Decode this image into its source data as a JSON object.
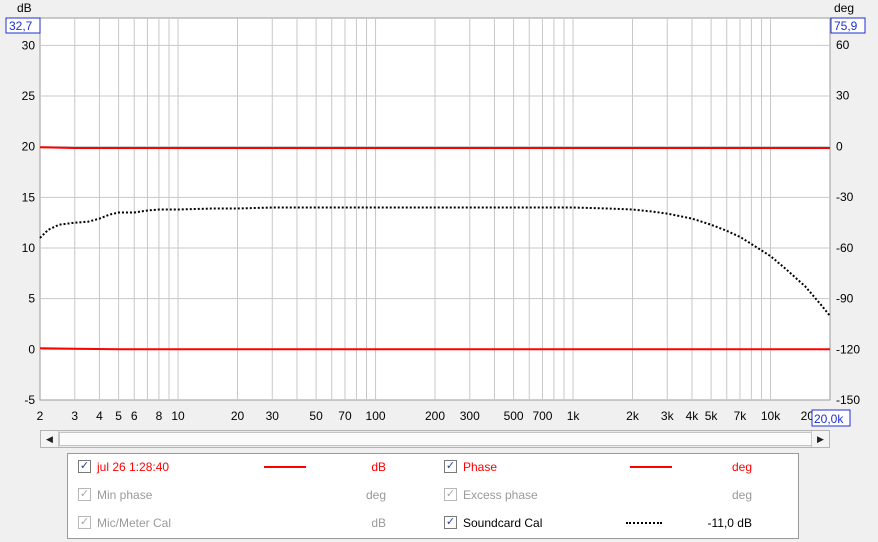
{
  "chart_data": {
    "type": "line",
    "left_axis_label": "dB",
    "right_axis_label": "deg",
    "left_top_value": "32,7",
    "right_top_value": "75,9",
    "right_end_value": "20,0k",
    "xscale": "log",
    "xlim": [
      2,
      20000
    ],
    "ylim_left": [
      -5,
      32.7
    ],
    "ylim_right": [
      -150,
      75.9
    ],
    "y_ticks_left": [
      30,
      25,
      20,
      15,
      10,
      5,
      0,
      -5
    ],
    "y_ticks_right": [
      60,
      30,
      0,
      -30,
      -60,
      -90,
      -120,
      -150
    ],
    "x_ticks": [
      {
        "v": 2,
        "label": "2"
      },
      {
        "v": 3,
        "label": "3"
      },
      {
        "v": 4,
        "label": "4"
      },
      {
        "v": 5,
        "label": "5"
      },
      {
        "v": 6,
        "label": "6"
      },
      {
        "v": 8,
        "label": "8"
      },
      {
        "v": 10,
        "label": "10"
      },
      {
        "v": 20,
        "label": "20"
      },
      {
        "v": 30,
        "label": "30"
      },
      {
        "v": 50,
        "label": "50"
      },
      {
        "v": 70,
        "label": "70"
      },
      {
        "v": 100,
        "label": "100"
      },
      {
        "v": 200,
        "label": "200"
      },
      {
        "v": 300,
        "label": "300"
      },
      {
        "v": 500,
        "label": "500"
      },
      {
        "v": 700,
        "label": "700"
      },
      {
        "v": 1000,
        "label": "1k"
      },
      {
        "v": 2000,
        "label": "2k"
      },
      {
        "v": 3000,
        "label": "3k"
      },
      {
        "v": 4000,
        "label": "4k"
      },
      {
        "v": 5000,
        "label": "5k"
      },
      {
        "v": 7000,
        "label": "7k"
      },
      {
        "v": 10000,
        "label": "10k"
      },
      {
        "v": 20000,
        "label": "20"
      }
    ],
    "series": [
      {
        "name": "jul 26 1:28:40",
        "axis": "left",
        "color": "#ff0000",
        "style": "solid",
        "x": [
          2,
          3,
          5,
          10,
          100,
          1000,
          10000,
          20000
        ],
        "y": [
          0.1,
          0.05,
          0,
          0,
          0,
          0,
          0,
          0
        ]
      },
      {
        "name": "Phase",
        "axis": "right",
        "color": "#ff0000",
        "style": "solid",
        "x": [
          2,
          3,
          5,
          10,
          100,
          1000,
          10000,
          20000
        ],
        "y": [
          -0.5,
          -1,
          -1,
          -1,
          -1,
          -1,
          -1,
          -1
        ]
      },
      {
        "name": "Soundcard Cal",
        "axis": "left",
        "color": "#000000",
        "style": "dotted",
        "x": [
          2,
          2.2,
          2.5,
          3,
          3.5,
          4,
          4.5,
          5,
          6,
          7,
          8,
          10,
          15,
          20,
          30,
          50,
          100,
          200,
          500,
          1000,
          1500,
          2000,
          2500,
          3000,
          4000,
          5000,
          6000,
          7000,
          8000,
          10000,
          12000,
          15000,
          18000,
          20000
        ],
        "y": [
          11.0,
          11.8,
          12.3,
          12.5,
          12.6,
          12.9,
          13.3,
          13.5,
          13.5,
          13.7,
          13.8,
          13.8,
          13.9,
          13.9,
          14.0,
          14.0,
          14.0,
          14.0,
          14.0,
          14.0,
          13.9,
          13.8,
          13.6,
          13.4,
          12.9,
          12.3,
          11.7,
          11.1,
          10.4,
          9.2,
          7.9,
          6.2,
          4.4,
          3.3
        ]
      }
    ]
  },
  "legend": {
    "rows": [
      [
        {
          "label": "jul 26 1:28:40",
          "checked": true,
          "enabled": true,
          "label_color": "red",
          "line": "solid",
          "unit": "dB",
          "unit_color": "red"
        },
        {
          "label": "Phase",
          "checked": true,
          "enabled": true,
          "label_color": "red",
          "line": "solid",
          "unit": "deg",
          "unit_color": "red"
        }
      ],
      [
        {
          "label": "Min phase",
          "checked": true,
          "enabled": false,
          "label_color": "grey",
          "line": "none",
          "unit": "deg",
          "unit_color": "grey"
        },
        {
          "label": "Excess phase",
          "checked": true,
          "enabled": false,
          "label_color": "grey",
          "line": "none",
          "unit": "deg",
          "unit_color": "grey"
        }
      ],
      [
        {
          "label": "Mic/Meter Cal",
          "checked": true,
          "enabled": false,
          "label_color": "grey",
          "line": "none",
          "unit": "dB",
          "unit_color": "grey"
        },
        {
          "label": "Soundcard Cal",
          "checked": true,
          "enabled": true,
          "label_color": "black",
          "line": "dotted",
          "unit": "-11,0 dB",
          "unit_color": "black"
        }
      ]
    ]
  },
  "scrollbar": {
    "left_icon": "◀",
    "right_icon": "▶"
  },
  "checkmark": "✓"
}
